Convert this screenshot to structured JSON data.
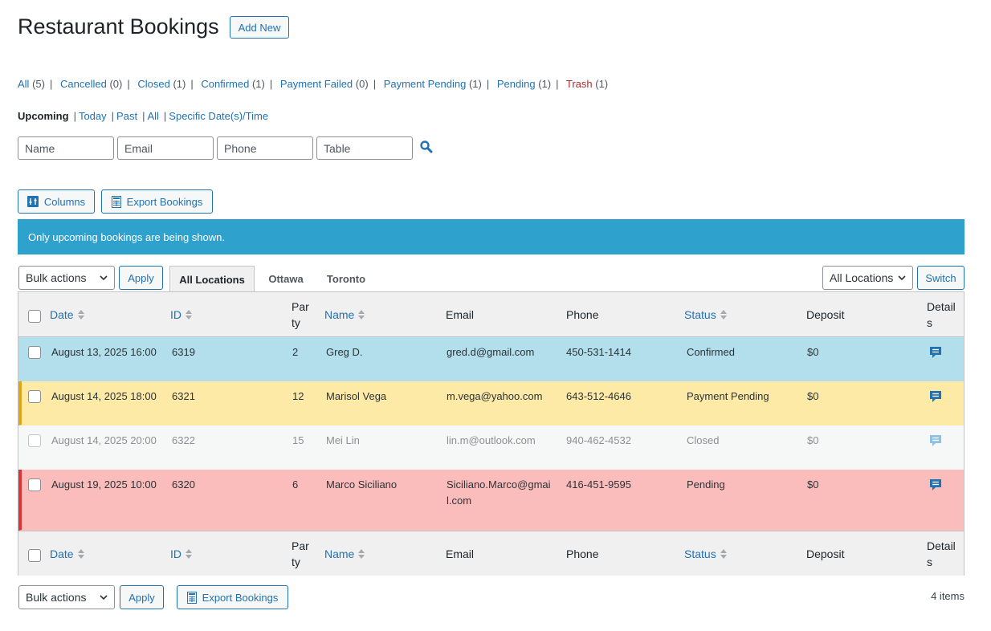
{
  "page": {
    "title": "Restaurant Bookings",
    "add_new": "Add New"
  },
  "status_filters": [
    {
      "label": "All",
      "count": "(5)"
    },
    {
      "label": "Cancelled",
      "count": "(0)"
    },
    {
      "label": "Closed",
      "count": "(1)"
    },
    {
      "label": "Confirmed",
      "count": "(1)"
    },
    {
      "label": "Payment Failed",
      "count": "(0)"
    },
    {
      "label": "Payment Pending",
      "count": "(1)"
    },
    {
      "label": "Pending",
      "count": "(1)"
    },
    {
      "label": "Trash",
      "count": "(1)"
    }
  ],
  "date_filters": {
    "current": "Upcoming",
    "links": [
      "Today",
      "Past",
      "All",
      "Specific Date(s)/Time"
    ]
  },
  "search": {
    "name_placeholder": "Name",
    "email_placeholder": "Email",
    "phone_placeholder": "Phone",
    "table_placeholder": "Table",
    "icon": "search-icon"
  },
  "toolbar": {
    "columns_label": "Columns",
    "export_label": "Export Bookings"
  },
  "notice": "Only upcoming bookings are being shown.",
  "bulk": {
    "top_value": "Bulk actions",
    "bottom_value": "Bulk actions",
    "apply_label": "Apply"
  },
  "location_tabs": [
    "All Locations",
    "Ottawa",
    "Toronto"
  ],
  "location_switch": {
    "value": "All Locations",
    "switch_label": "Switch"
  },
  "columns": {
    "date": "Date",
    "id": "ID",
    "party_1": "Par",
    "party_2": "ty",
    "name": "Name",
    "email": "Email",
    "phone": "Phone",
    "status": "Status",
    "deposit": "Deposit",
    "details_1": "Detail",
    "details_2": "s"
  },
  "rows": [
    {
      "date": "August 13, 2025 16:00",
      "id": "6319",
      "party": "2",
      "name": "Greg D.",
      "email_1": "gred.d@gmail.com",
      "email_2": "",
      "phone": "450-531-1414",
      "status": "Confirmed",
      "deposit": "$0",
      "bg": "#b3deeb",
      "accent": ""
    },
    {
      "date": "August 14, 2025 18:00",
      "id": "6321",
      "party": "12",
      "name": "Marisol Vega",
      "email_1": "m.vega@yahoo.com",
      "email_2": "",
      "phone": "643-512-4646",
      "status": "Payment Pending",
      "deposit": "$0",
      "bg": "#fdeaa7",
      "accent": "#dba617"
    },
    {
      "date": "August 14, 2025 20:00",
      "id": "6322",
      "party": "15",
      "name": "Mei Lin",
      "email_1": "lin.m@outlook.com",
      "email_2": "",
      "phone": "940-462-4532",
      "status": "Closed",
      "deposit": "$0",
      "bg": "#f6f7f7",
      "accent": ""
    },
    {
      "date": "August 19, 2025 10:00",
      "id": "6320",
      "party": "6",
      "name": "Marco Siciliano",
      "email_1": "Siciliano.Marco@gmai",
      "email_2": "l.com",
      "phone": "416-451-9595",
      "status": "Pending",
      "deposit": "$0",
      "bg": "#fbbcbc",
      "accent": "#d63638"
    }
  ],
  "items_count": "4 items",
  "colors": {
    "accent": "#2271b1",
    "notice": "#2ea2cc",
    "trash": "#b32d2e"
  }
}
